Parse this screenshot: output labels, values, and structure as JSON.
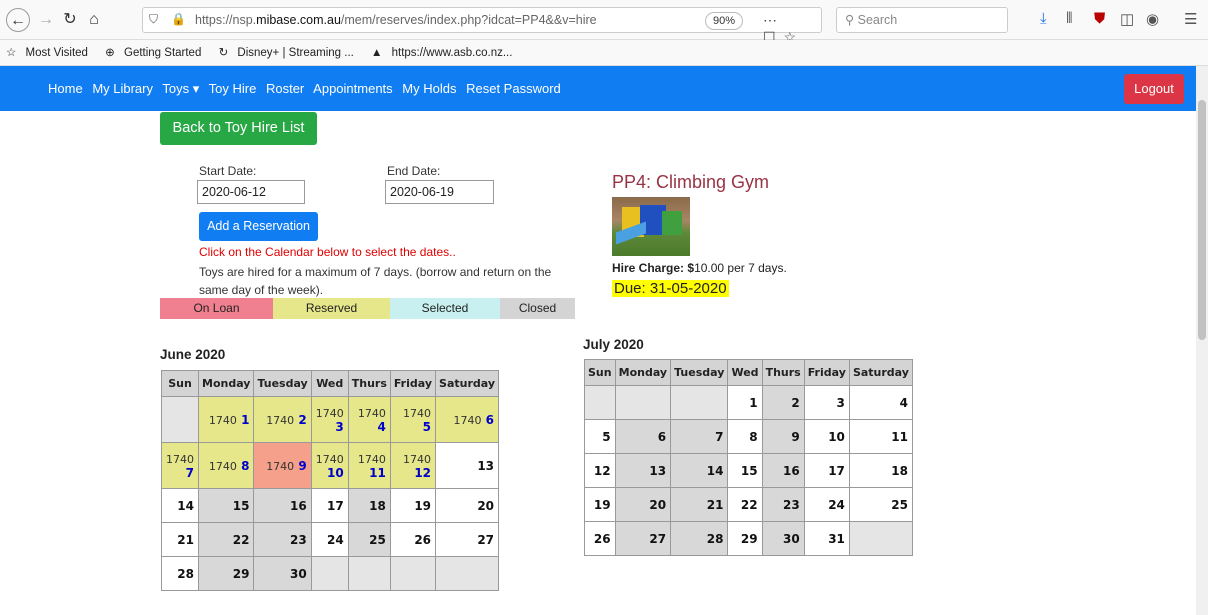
{
  "browser": {
    "url_prefix": "https://nsp.",
    "url_domain": "mibase.com.au",
    "url_rest": "/mem/reserves/index.php?idcat=PP4&&v=hire",
    "zoom": "90%",
    "search_placeholder": "Search"
  },
  "bookmarks": [
    "Most Visited",
    "Getting Started",
    "Disney+ | Streaming ...",
    "https://www.asb.co.nz..."
  ],
  "nav": {
    "links": [
      "Home",
      "My Library",
      "Toys ▾",
      "Toy Hire",
      "Roster",
      "Appointments",
      "My Holds",
      "Reset Password"
    ],
    "logout": "Logout"
  },
  "back_label": "Back to Toy Hire List",
  "form": {
    "start_label": "Start Date:",
    "start_value": "2020-06-12",
    "end_label": "End Date:",
    "end_value": "2020-06-19",
    "add_label": "Add a Reservation",
    "hint": "Click on the Calendar below to select the dates..",
    "info": "Toys are hired for a maximum of 7 days. (borrow and return on the same day of the week)."
  },
  "legend": {
    "on_loan": "On Loan",
    "reserved": "Reserved",
    "selected": "Selected",
    "closed": "Closed"
  },
  "product": {
    "title": "PP4: Climbing Gym",
    "hire_label": "Hire Charge:",
    "hire_currency": "$",
    "hire_amount": "10.00",
    "hire_suffix": " per 7 days.",
    "due": "Due: 31-05-2020"
  },
  "june": {
    "title": "June 2020",
    "headers": [
      "Sun",
      "Monday",
      "Tuesday",
      "Wed",
      "Thurs",
      "Friday",
      "Saturday"
    ]
  },
  "july": {
    "title": "July 2020",
    "headers": [
      "Sun",
      "Monday",
      "Tuesday",
      "Wed",
      "Thurs",
      "Friday",
      "Saturday"
    ]
  }
}
